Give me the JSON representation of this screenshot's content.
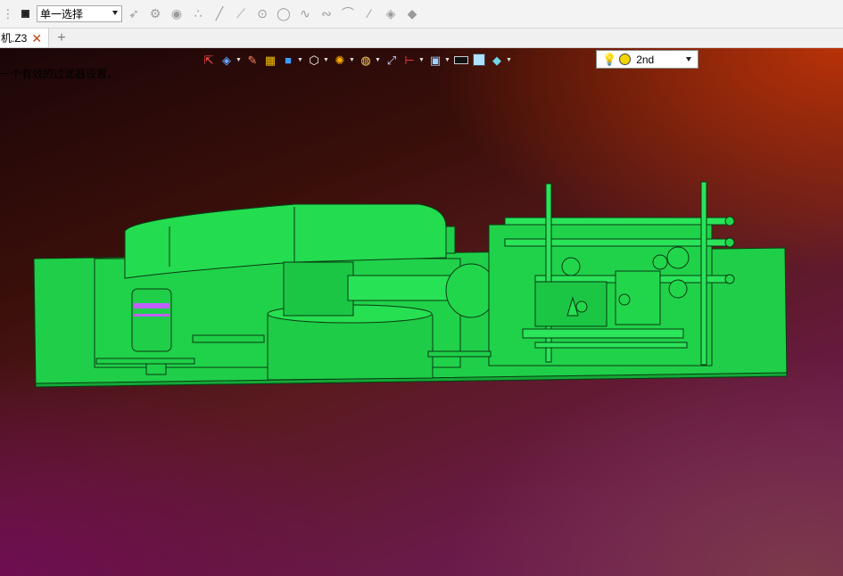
{
  "toolbar": {
    "selection_mode": "单一选择",
    "icons": [
      "stop-icon",
      "select-arrow-icon",
      "filter-icon",
      "play-circle-icon",
      "point-icon",
      "line-icon",
      "line2-icon",
      "circle-center-icon",
      "circle-icon",
      "curve-icon",
      "curve2-icon",
      "arc-icon",
      "slash-icon",
      "solid-icon",
      "solid2-icon"
    ]
  },
  "tabs": {
    "active_label": "机.Z3",
    "close_symbol": "✕",
    "add_symbol": "+"
  },
  "status": {
    "message": "一个有效的过滤器设置。"
  },
  "view_toolbar": {
    "items": [
      "exit-icon",
      "render-mode-icon",
      "pencil-icon",
      "box-yellow-icon",
      "box-blue-icon",
      "cube-white-icon",
      "shade-orange-icon",
      "light-sphere-icon",
      "fit-view-icon",
      "section-icon",
      "display-icon",
      "black-rect-icon",
      "blue-square-icon",
      "layer-icon"
    ],
    "light_preset": "2nd"
  },
  "colors": {
    "model_green": "#1fd14a",
    "model_edge": "#0a3a12"
  }
}
